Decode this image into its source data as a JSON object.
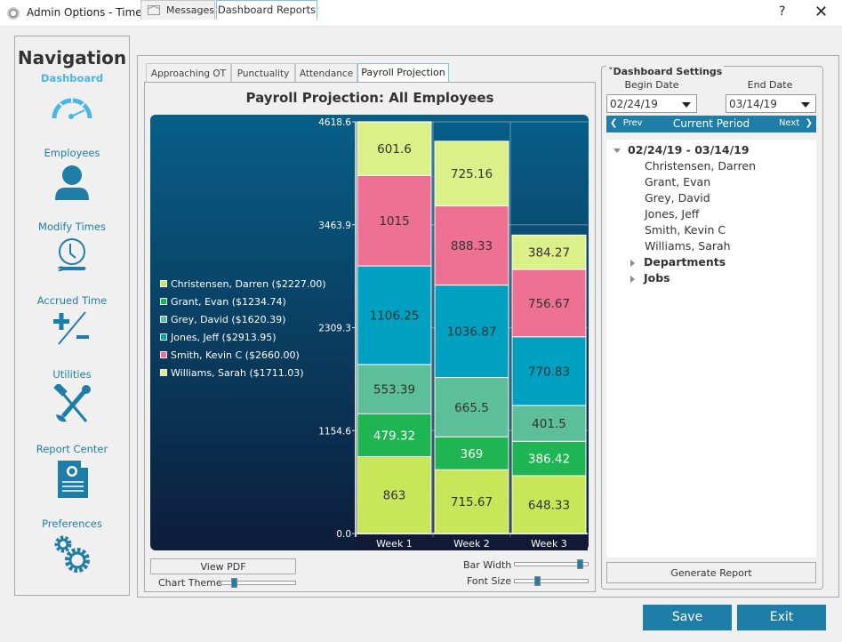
{
  "window": {
    "title": "Admin Options - TimeClick",
    "help": "?",
    "close": "✕"
  },
  "nav": {
    "title": "Navigation",
    "items": [
      {
        "label": "Dashboard",
        "icon": "gauge-icon",
        "active": true
      },
      {
        "label": "Employees",
        "icon": "person-icon"
      },
      {
        "label": "Modify Times",
        "icon": "clock-wrench-icon"
      },
      {
        "label": "Accrued Time",
        "icon": "plus-minus-icon"
      },
      {
        "label": "Utilities",
        "icon": "tools-icon"
      },
      {
        "label": "Report Center",
        "icon": "report-icon"
      },
      {
        "label": "Preferences",
        "icon": "gears-icon"
      }
    ]
  },
  "top_tabs": [
    {
      "label": "Messages",
      "icon": "envelope-icon"
    },
    {
      "label": "Dashboard Reports",
      "active": true
    }
  ],
  "sub_tabs": [
    {
      "label": "Approaching OT"
    },
    {
      "label": "Punctuality"
    },
    {
      "label": "Attendance"
    },
    {
      "label": "Payroll Projection",
      "active": true
    }
  ],
  "chart_data": {
    "type": "bar",
    "stacked": true,
    "title": "Payroll Projection: All Employees",
    "categories": [
      "Week 1",
      "Week 2",
      "Week 3"
    ],
    "ylim": [
      0,
      4618.6
    ],
    "yticks": [
      "0.0",
      "1154.6",
      "2309.3",
      "3463.9",
      "4618.6"
    ],
    "grid": true,
    "legend_position": "left",
    "series": [
      {
        "name": "Christensen, Darren ($2227.00)",
        "color": "#c8e65a",
        "values": [
          863,
          715.67,
          648.33
        ],
        "labels": [
          "863",
          "715.67",
          "648.33"
        ]
      },
      {
        "name": "Grant, Evan ($1234.74)",
        "color": "#1fb552",
        "values": [
          479.32,
          369,
          386.42
        ],
        "labels": [
          "479.32",
          "369",
          "386.42"
        ]
      },
      {
        "name": "Grey, David ($1620.39)",
        "color": "#5cbf9a",
        "values": [
          553.39,
          665.5,
          401.5
        ],
        "labels": [
          "553.39",
          "665.5",
          "401.5"
        ]
      },
      {
        "name": "Jones, Jeff ($2913.95)",
        "color": "#00a0c0",
        "values": [
          1106.25,
          1036.87,
          770.83
        ],
        "labels": [
          "1106.25",
          "1036.87",
          "770.83"
        ]
      },
      {
        "name": "Smith, Kevin C ($2660.00)",
        "color": "#ee7093",
        "values": [
          1015,
          888.33,
          756.67
        ],
        "labels": [
          "1015",
          "888.33",
          "756.67"
        ]
      },
      {
        "name": "Williams, Sarah ($1711.03)",
        "color": "#dcf08a",
        "values": [
          601.6,
          725.16,
          384.27
        ],
        "labels": [
          "601.6",
          "725.16",
          "384.27"
        ]
      }
    ]
  },
  "chart_controls": {
    "view_pdf": "View PDF",
    "chart_theme": {
      "label": "Chart Theme",
      "value": 0.15
    },
    "bar_width": {
      "label": "Bar Width",
      "value": 0.95
    },
    "font_size": {
      "label": "Font Size",
      "value": 0.3
    }
  },
  "settings": {
    "header": "Dashboard Settings",
    "begin_label": "Begin Date",
    "end_label": "End Date",
    "begin_value": "02/24/19",
    "end_value": "03/14/19",
    "prev": "Prev",
    "current": "Current Period",
    "next": "Next",
    "tree": {
      "period": "02/24/19 - 03/14/19",
      "employees": [
        "Christensen, Darren",
        "Grant, Evan",
        "Grey, David",
        "Jones, Jeff",
        "Smith, Kevin C",
        "Williams, Sarah"
      ],
      "groups": [
        "Departments",
        "Jobs"
      ]
    },
    "generate": "Generate Report"
  },
  "footer": {
    "save": "Save",
    "exit": "Exit"
  },
  "colors": {
    "accent": "#1f7ea7",
    "nav_active": "#4ab6e6"
  }
}
